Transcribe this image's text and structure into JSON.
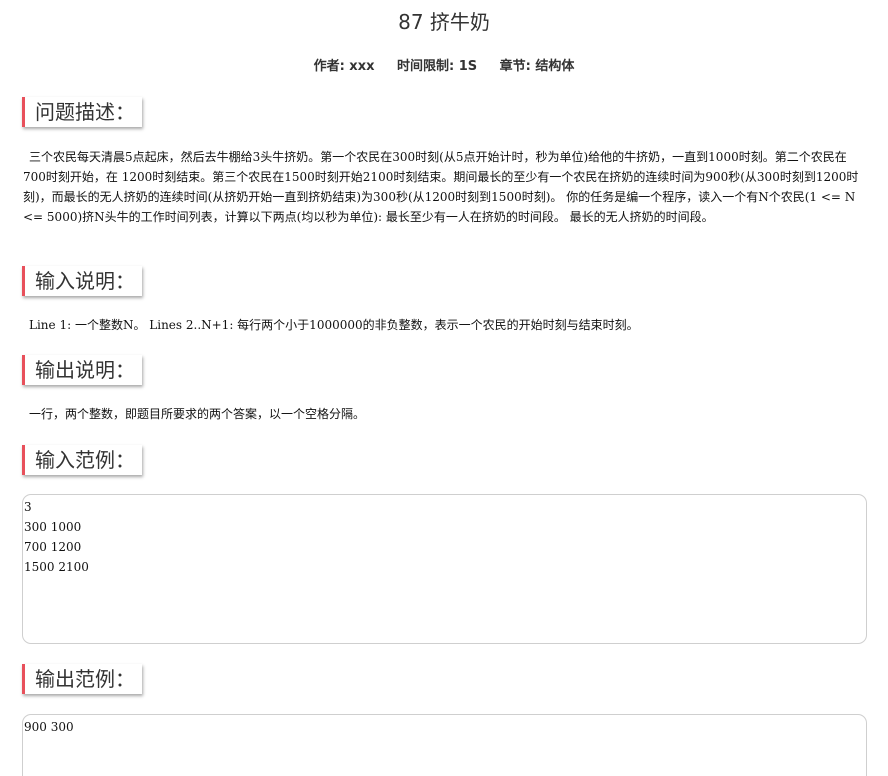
{
  "problem": {
    "title": "87 挤牛奶",
    "meta": {
      "author": "作者: xxx",
      "time_limit": "时间限制: 1S",
      "chapter": "章节: 结构体"
    }
  },
  "sections": {
    "description": {
      "heading": "问题描述：",
      "text": "三个农民每天清晨5点起床，然后去牛棚给3头牛挤奶。第一个农民在300时刻(从5点开始计时，秒为单位)给他的牛挤奶，一直到1000时刻。第二个农民在700时刻开始，在 1200时刻结束。第三个农民在1500时刻开始2100时刻结束。期间最长的至少有一个农民在挤奶的连续时间为900秒(从300时刻到1200时刻)，而最长的无人挤奶的连续时间(从挤奶开始一直到挤奶结束)为300秒(从1200时刻到1500时刻)。 你的任务是编一个程序，读入一个有N个农民(1 <= N <= 5000)挤N头牛的工作时间列表，计算以下两点(均以秒为单位): 最长至少有一人在挤奶的时间段。 最长的无人挤奶的时间段。"
    },
    "input_desc": {
      "heading": "输入说明：",
      "text": "Line 1: 一个整数N。 Lines 2..N+1: 每行两个小于1000000的非负整数，表示一个农民的开始时刻与结束时刻。"
    },
    "output_desc": {
      "heading": "输出说明：",
      "text": "一行，两个整数，即题目所要求的两个答案，以一个空格分隔。"
    },
    "input_example": {
      "heading": "输入范例：",
      "text": "3\n300 1000\n700 1200\n1500 2100"
    },
    "output_example": {
      "heading": "输出范例：",
      "text": "900 300"
    }
  },
  "colors": {
    "accent": "#e8505b",
    "box_border": "#cfcfcf"
  }
}
